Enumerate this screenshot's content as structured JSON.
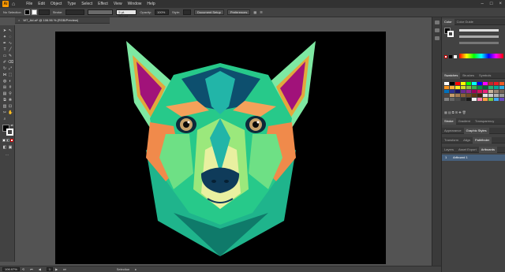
{
  "menubar": {
    "items": [
      "File",
      "Edit",
      "Object",
      "Type",
      "Select",
      "Effect",
      "View",
      "Window",
      "Help"
    ],
    "window_controls": [
      "–",
      "□",
      "×"
    ]
  },
  "controlbar": {
    "selection": "No Selection",
    "stroke_label": "Stroke:",
    "brush": "5 pt. Round",
    "opacity_label": "Opacity:",
    "opacity_value": "100%",
    "style_label": "Style:",
    "doc_setup": "Document Setup",
    "preferences": "Preferences"
  },
  "document": {
    "tab_title": "W7_Ad.ai* @ 106.96 % (RGB/Preview)",
    "close": "×"
  },
  "statusbar": {
    "zoom": "106.97%",
    "artboard_num": "1",
    "tool_label": "Selection"
  },
  "panels": {
    "color_tabs": [
      "Color",
      "Color Guide"
    ],
    "swatches_tabs": [
      "Swatches",
      "Brushes",
      "Symbols"
    ],
    "stroke_tabs": [
      "Stroke",
      "Gradient",
      "Transparency"
    ],
    "appearance_tabs": [
      "Appearance",
      "Graphic Styles"
    ],
    "transform_tabs": [
      "Transform",
      "Align",
      "Pathfinder"
    ],
    "layers_tabs": [
      "Layers",
      "Asset Export",
      "Artboards"
    ],
    "artboard_row": "Artboard 1",
    "artboard_index": "1",
    "swatch_colors": [
      "#ffffff",
      "#000000",
      "#ff0000",
      "#ffff00",
      "#00ff00",
      "#00ffff",
      "#0000ff",
      "#ff00ff",
      "#c1272d",
      "#ed1c24",
      "#f15a24",
      "#f7931e",
      "#fbb03b",
      "#fcee21",
      "#d9e021",
      "#8cc63f",
      "#39b54a",
      "#009245",
      "#006837",
      "#22b573",
      "#00a99d",
      "#29abe2",
      "#0071bc",
      "#2e3192",
      "#1b1464",
      "#662d91",
      "#93278f",
      "#9e005d",
      "#d4145a",
      "#ed1e79",
      "#c7b299",
      "#998675",
      "#736357",
      "#534741",
      "#c69c6d",
      "#a67c52",
      "#8c6239",
      "#754c24",
      "#603813",
      "#42210b",
      "#e6e6e6",
      "#cccccc",
      "#b3b3b3",
      "#999999",
      "#808080",
      "#666666",
      "#4d4d4d",
      "#333333",
      "#1a1a1a",
      "#f2f2f2",
      "#ff7bac",
      "#ff9f40",
      "#7ac943",
      "#3fa9f5",
      "#6a4bc4"
    ]
  },
  "colors": {
    "canvas_bg": "#535353",
    "artboard": "#000000",
    "panel": "#424242",
    "accent": "#ff9a00"
  }
}
